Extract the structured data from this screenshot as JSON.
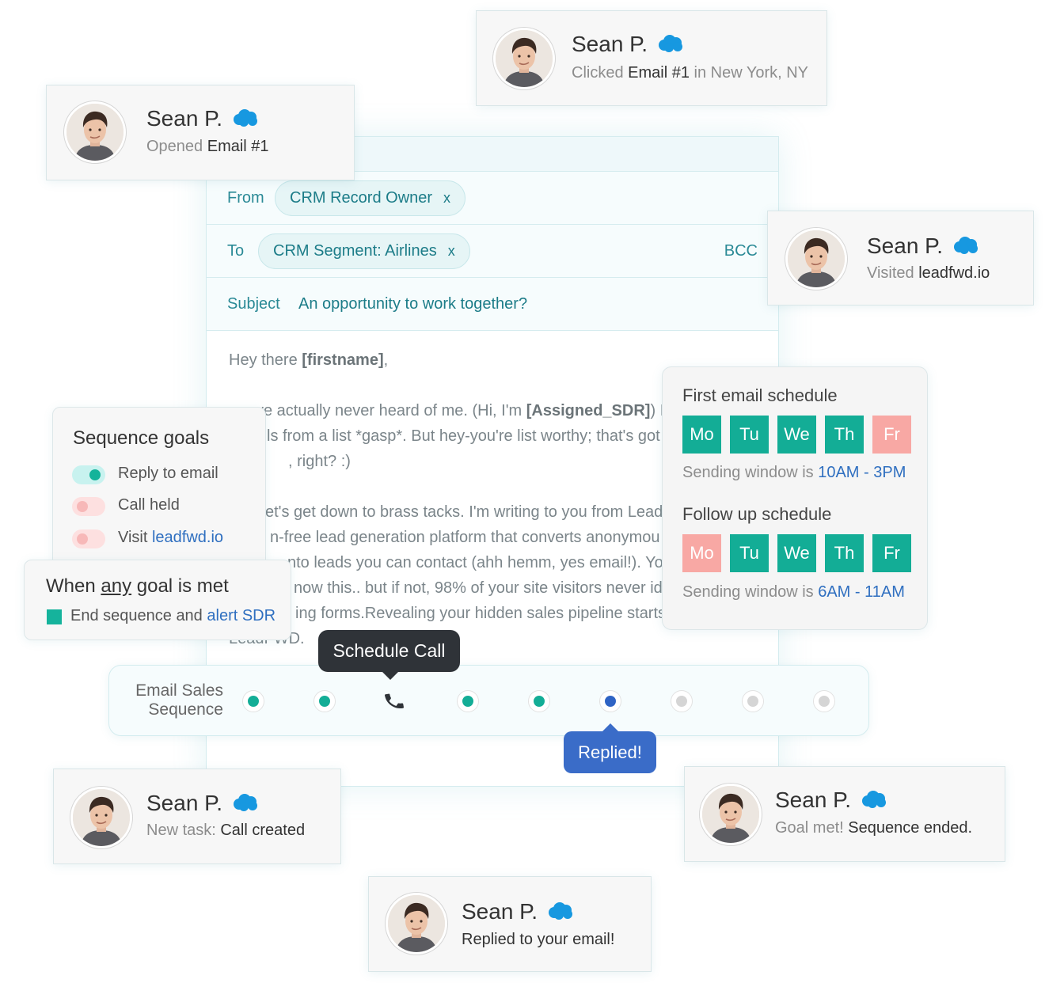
{
  "composer": {
    "from_label": "From",
    "from_value": "CRM Record Owner",
    "to_label": "To",
    "to_value": "CRM Segment: Airlines",
    "remove_symbol": "x",
    "bcc_label": "BCC",
    "subject_label": "Subject",
    "subject_value": "An opportunity to work together?",
    "body": {
      "greeting_prefix": "Hey there ",
      "greeting_token": "[firstname]",
      "greeting_suffix": ",",
      "p1_line1_prefix": "ve actually never heard of me. (Hi, I'm ",
      "p1_token": "[Assigned_SDR]",
      "p1_line1_suffix": ") I g",
      "p1_line2": "ls from a list *gasp*. But hey-you're list worthy; that's got",
      "p1_line3": ", right? :)",
      "p2_line1": "et's get down to brass tacks. I'm writing to you from Lead",
      "p2_line2": "n-free lead generation platform that converts anonymou",
      "p2_line3": "nto leads you can contact (ahh hemm, yes email!). Yo",
      "p2_line4": "now this.. but if not, 98% of your site visitors never ide",
      "p2_line5": "ing forms.Revealing your hidden sales pipeline starts",
      "signoff": "LeadFWD."
    }
  },
  "notifications": [
    {
      "name": "Sean P.",
      "sub_prefix": "Clicked ",
      "sub_highlight": "Email #1",
      "sub_suffix": " in New York, NY"
    },
    {
      "name": "Sean P.",
      "sub_prefix": "Opened ",
      "sub_highlight": "Email #1",
      "sub_suffix": ""
    },
    {
      "name": "Sean P.",
      "sub_prefix": "Visited ",
      "sub_highlight": "leadfwd.io",
      "sub_suffix": ""
    },
    {
      "name": "Sean P.",
      "sub_prefix": "New task: ",
      "sub_highlight": "Call created",
      "sub_suffix": ""
    },
    {
      "name": "Sean P.",
      "sub_prefix": "Goal met! ",
      "sub_highlight": "Sequence ended.",
      "sub_suffix": ""
    },
    {
      "name": "Sean P.",
      "sub_prefix": "",
      "sub_highlight": "Replied to your email!",
      "sub_suffix": ""
    }
  ],
  "goals": {
    "title": "Sequence goals",
    "items": [
      {
        "label": "Reply to email",
        "link": "",
        "enabled": true
      },
      {
        "label": "Call held",
        "link": "",
        "enabled": false
      },
      {
        "label": "Visit ",
        "link": "leadfwd.io",
        "enabled": false
      }
    ]
  },
  "goal_met": {
    "title_prefix": "When ",
    "title_emph": "any",
    "title_suffix": " goal is met",
    "action_prefix": "End sequence and ",
    "action_link": "alert SDR"
  },
  "schedule": {
    "first": {
      "title": "First email schedule",
      "days": [
        {
          "label": "Mo",
          "active": true
        },
        {
          "label": "Tu",
          "active": true
        },
        {
          "label": "We",
          "active": true
        },
        {
          "label": "Th",
          "active": true
        },
        {
          "label": "Fr",
          "active": false
        }
      ],
      "window_prefix": "Sending window is ",
      "window_value": "10AM - 3PM"
    },
    "follow": {
      "title": "Follow up schedule",
      "days": [
        {
          "label": "Mo",
          "active": false
        },
        {
          "label": "Tu",
          "active": true
        },
        {
          "label": "We",
          "active": true
        },
        {
          "label": "Th",
          "active": true
        },
        {
          "label": "Fr",
          "active": true
        }
      ],
      "window_prefix": "Sending window is ",
      "window_value": "6AM - 11AM"
    }
  },
  "sequence": {
    "label_line1": "Email Sales",
    "label_line2": "Sequence",
    "steps": [
      "done",
      "done",
      "call",
      "done",
      "done",
      "current",
      "pending",
      "pending",
      "pending"
    ],
    "call_tooltip": "Schedule Call",
    "replied_tooltip": "Replied!"
  },
  "colors": {
    "accent_teal": "#13ad96",
    "inactive_pink": "#f8a8a4",
    "link_blue": "#2f6fc0",
    "tooltip_dark": "#2f3338",
    "tooltip_blue": "#3a6cc8",
    "crm_cloud": "#1798e0"
  },
  "icons": {
    "crm": "cloud-icon",
    "avatar": "avatar",
    "call_step": "phone-icon"
  }
}
